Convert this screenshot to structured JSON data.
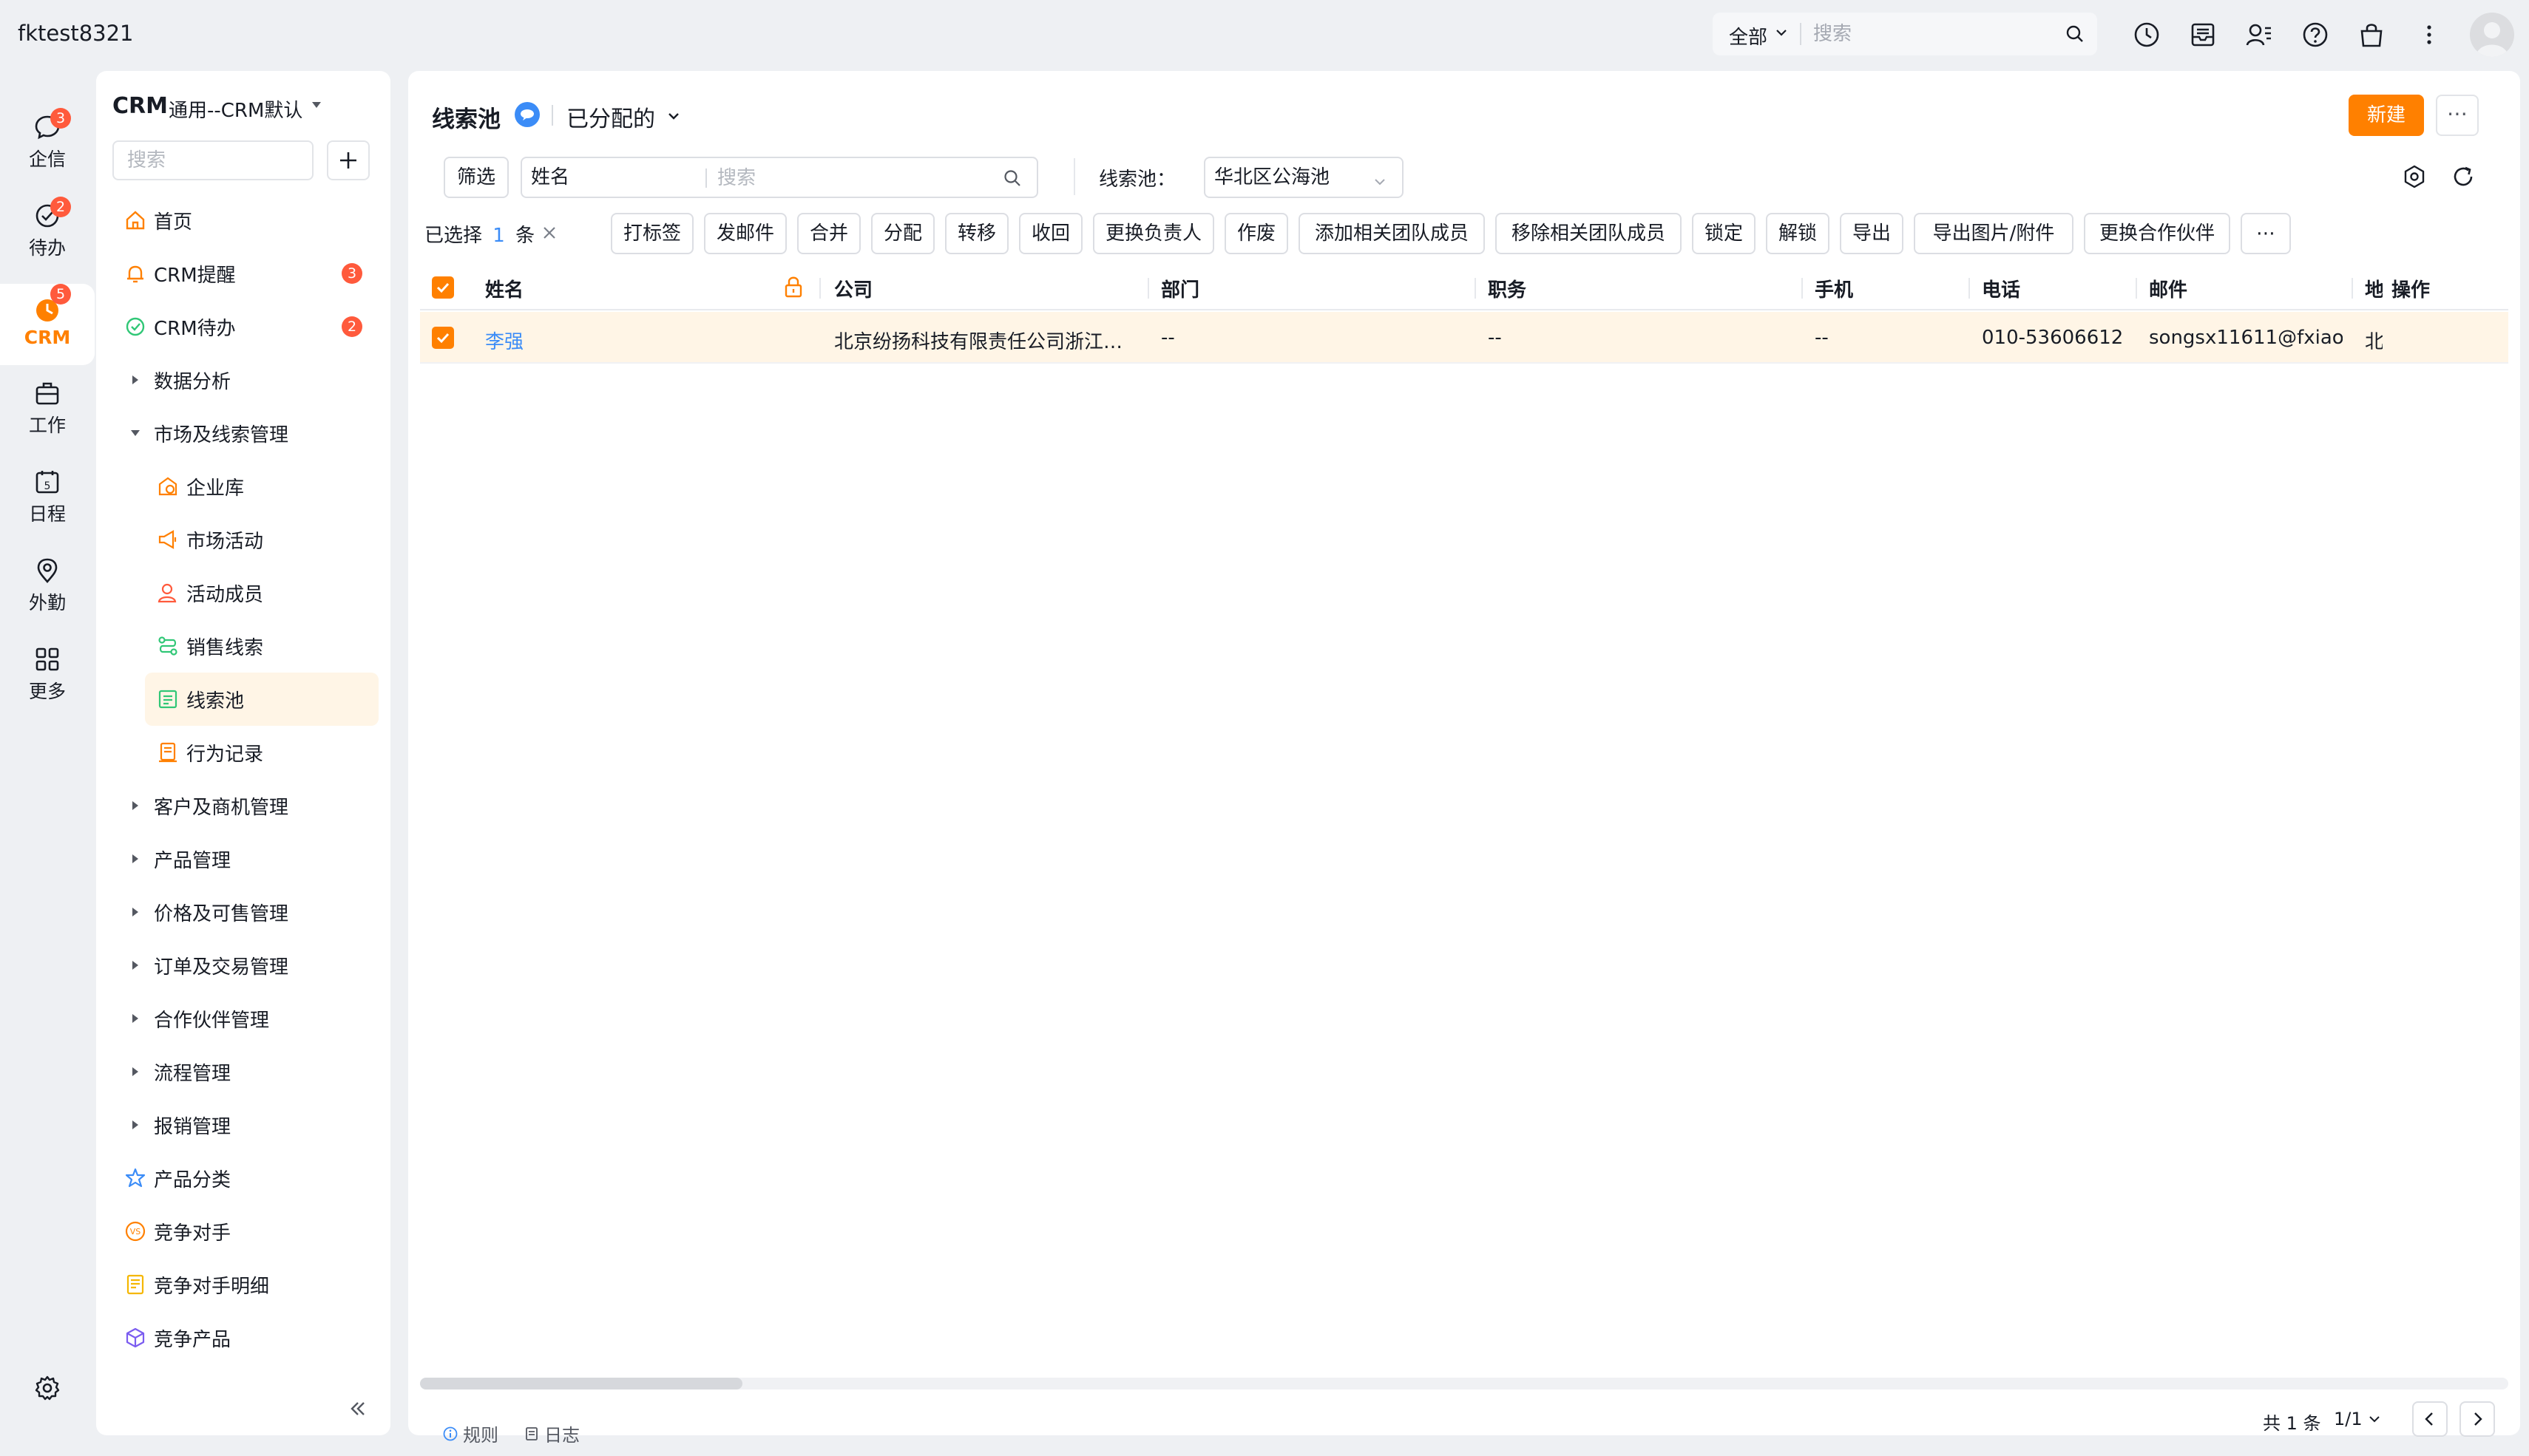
{
  "topbar": {
    "account": "fktest8321",
    "search_scope": "全部",
    "search_placeholder": "搜索",
    "icons": [
      "clock-icon",
      "inbox-icon",
      "contacts-icon",
      "help-icon",
      "bag-icon",
      "kebab-icon"
    ]
  },
  "rail": {
    "items": [
      {
        "label": "企信",
        "badge": "3",
        "icon": "chat-icon"
      },
      {
        "label": "待办",
        "badge": "2",
        "icon": "todo-icon"
      },
      {
        "label": "CRM",
        "badge": "5",
        "icon": "crm-icon",
        "active": true
      },
      {
        "label": "工作",
        "icon": "briefcase-icon"
      },
      {
        "label": "日程",
        "icon": "calendar-icon"
      },
      {
        "label": "外勤",
        "icon": "location-icon"
      },
      {
        "label": "更多",
        "icon": "grid-icon"
      }
    ]
  },
  "sidebar": {
    "title_main": "CRM",
    "title_sub": "通用--CRM默认",
    "search_placeholder": "搜索",
    "items": [
      {
        "label": "首页"
      },
      {
        "label": "CRM提醒",
        "badge": "3"
      },
      {
        "label": "CRM待办",
        "badge": "2"
      },
      {
        "label": "数据分析"
      },
      {
        "label": "市场及线索管理"
      },
      {
        "label": "企业库"
      },
      {
        "label": "市场活动"
      },
      {
        "label": "活动成员"
      },
      {
        "label": "销售线索"
      },
      {
        "label": "线索池"
      },
      {
        "label": "行为记录"
      },
      {
        "label": "客户及商机管理"
      },
      {
        "label": "产品管理"
      },
      {
        "label": "价格及可售管理"
      },
      {
        "label": "订单及交易管理"
      },
      {
        "label": "合作伙伴管理"
      },
      {
        "label": "流程管理"
      },
      {
        "label": "报销管理"
      },
      {
        "label": "产品分类"
      },
      {
        "label": "竞争对手"
      },
      {
        "label": "竞争对手明细"
      },
      {
        "label": "竞争产品"
      }
    ]
  },
  "page": {
    "title": "线索池",
    "view": "已分配的",
    "new_button": "新建",
    "more_button": "⋯",
    "filter_button": "筛选",
    "field_select": "姓名",
    "search_placeholder": "搜索",
    "pool_label": "线索池：",
    "pool_value": "华北区公海池",
    "selected_prefix": "已选择",
    "selected_count": "1",
    "selected_suffix": "条",
    "actions": [
      "打标签",
      "发邮件",
      "合并",
      "分配",
      "转移",
      "收回",
      "更换负责人",
      "作废",
      "添加相关团队成员",
      "移除相关团队成员",
      "锁定",
      "解锁",
      "导出",
      "导出图片/附件",
      "更换合作伙伴",
      "⋯"
    ]
  },
  "table": {
    "columns": [
      "姓名",
      "公司",
      "部门",
      "职务",
      "手机",
      "电话",
      "邮件",
      "地",
      "操作"
    ],
    "rows": [
      {
        "name": "李强",
        "company": "北京纷扬科技有限责任公司浙江…",
        "dept": "--",
        "title": "--",
        "mobile": "--",
        "phone": "010-53606612",
        "email": "songsx11611@fxiao…",
        "addr": "北"
      }
    ]
  },
  "footer": {
    "rules": "规则",
    "log": "日志",
    "total": "共 1 条",
    "pages": "1/1"
  },
  "colors": {
    "accent": "#ff8000",
    "link": "#3b8cf7",
    "badge": "#ff5a3c",
    "active_row": "#fff5e6"
  }
}
